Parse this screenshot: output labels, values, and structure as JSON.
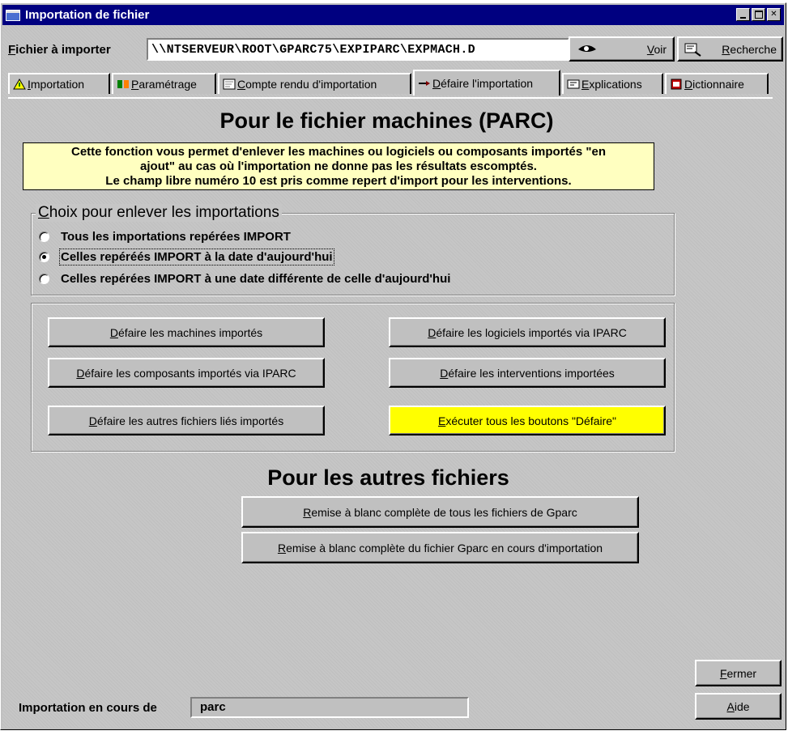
{
  "window": {
    "title": "Importation de fichier"
  },
  "file": {
    "label_underlined": "F",
    "label_rest": "ichier à importer",
    "path": "\\\\NTSERVEUR\\ROOT\\GPARC75\\EXPIPARC\\EXPMACH.D",
    "voir_u": "V",
    "voir_rest": "oir",
    "recherche_u": "R",
    "recherche_rest": "echerche"
  },
  "tabs": [
    {
      "u": "I",
      "rest": "mportation",
      "icon": "warning-triangle-icon"
    },
    {
      "u": "P",
      "rest": "aramétrage",
      "icon": "parameters-icon"
    },
    {
      "u": "C",
      "rest": "ompte rendu d'importation",
      "icon": "report-icon"
    },
    {
      "u": "D",
      "rest": "éfaire l'importation",
      "icon": "undo-arrow-icon"
    },
    {
      "u": "E",
      "rest": "xplications",
      "icon": "help-icon"
    },
    {
      "u": "D",
      "rest": "ictionnaire",
      "icon": "dictionary-icon"
    }
  ],
  "main": {
    "heading_machines": "Pour le fichier machines (PARC)",
    "note_lines": [
      "Cette fonction vous permet d'enlever les machines ou logiciels ou composants importés \"en",
      "ajout\" au cas où l'importation ne donne pas les résultats escomptés.",
      "Le champ libre numéro 10 est pris comme repert d'import pour les interventions."
    ],
    "choice_title_u": "C",
    "choice_title_rest": "hoix pour enlever les importations",
    "radios": [
      {
        "label": "Tous les importations repérées IMPORT",
        "checked": false
      },
      {
        "label": "Celles repéréés IMPORT à la date d'aujourd'hui",
        "checked": true
      },
      {
        "label": "Celles repérées IMPORT à une date différente de celle d'aujourd'hui",
        "checked": false
      }
    ],
    "undo_buttons": {
      "machines": {
        "u": "D",
        "rest": "éfaire les machines importés"
      },
      "logiciels": {
        "u": "D",
        "rest": "éfaire les logiciels importés via IPARC"
      },
      "composants": {
        "u": "D",
        "rest": "éfaire les composants importés via IPARC"
      },
      "interventions": {
        "u": "D",
        "rest": "éfaire les interventions importées"
      },
      "autres": {
        "u": "D",
        "rest": "éfaire les autres fichiers liés importés"
      },
      "executer": {
        "u": "E",
        "rest": "xécuter tous les boutons \"Défaire\""
      }
    },
    "heading_autres": "Pour les autres fichiers",
    "reset_all": {
      "u": "R",
      "rest": "emise à blanc complète de tous les fichiers de Gparc"
    },
    "reset_current": {
      "u": "R",
      "rest": "emise à blanc complète du fichier Gparc en cours d'importation"
    }
  },
  "footer": {
    "status_label": "Importation en cours de",
    "status_value": "parc",
    "fermer_u": "F",
    "fermer_rest": "ermer",
    "aide_u": "A",
    "aide_rest": "ide"
  },
  "colors": {
    "titlebar": "#000080",
    "face": "#c0c0c0",
    "note_bg": "#ffffc0",
    "execute_btn": "#ffff00"
  }
}
